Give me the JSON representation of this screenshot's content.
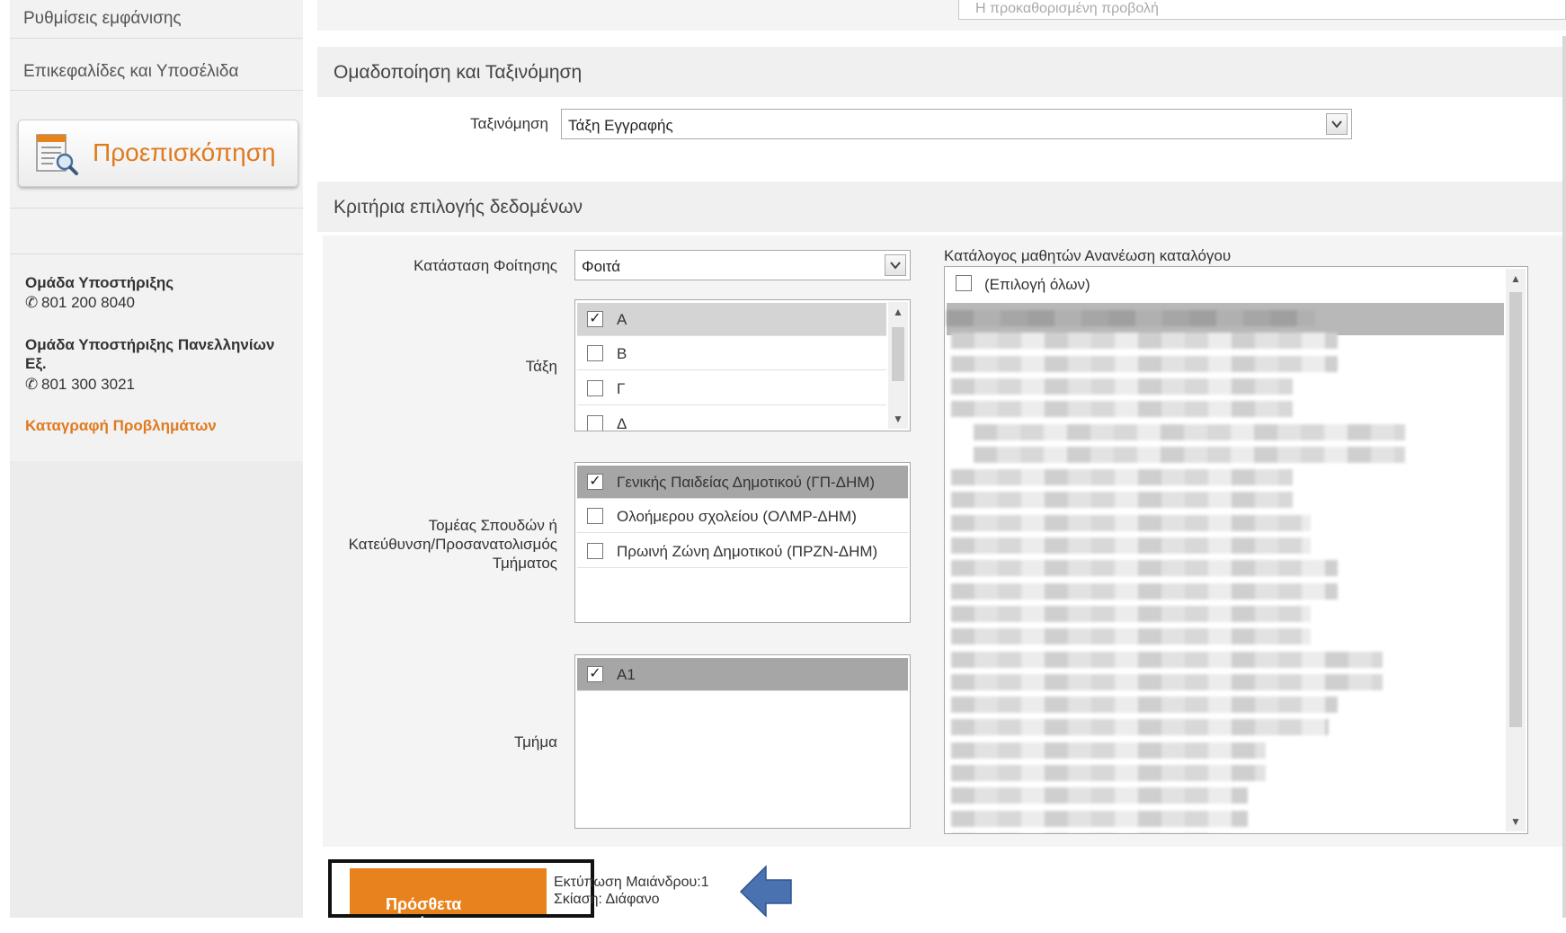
{
  "sidebar": {
    "links": [
      "Ρυθμίσεις εμφάνισης",
      "Επικεφαλίδες και Υποσέλιδα"
    ],
    "preview_button": "Προεπισκόπηση",
    "support": [
      {
        "title": "Ομάδα Υποστήριξης",
        "phone": "801 200 8040"
      },
      {
        "title": "Ομάδα Υποστήριξης Πανελληνίων Εξ.",
        "phone": "801 300 3021"
      }
    ],
    "report_link": "Καταγραφή Προβλημάτων"
  },
  "top": {
    "dropdown_placeholder": "Η προκαθορισμένη προβολή"
  },
  "grouping": {
    "header": "Ομαδοποίηση και Ταξινόμηση",
    "sort_label": "Ταξινόμηση",
    "sort_value": "Τάξη Εγγραφής"
  },
  "criteria": {
    "header": "Κριτήρια επιλογής δεδομένων",
    "status_label": "Κατάσταση Φοίτησης",
    "status_value": "Φοιτά",
    "class_label": "Τάξη",
    "class_items": [
      {
        "label": "Α",
        "checked": true
      },
      {
        "label": "Β",
        "checked": false
      },
      {
        "label": "Γ",
        "checked": false
      },
      {
        "label": "Δ",
        "checked": false
      }
    ],
    "sector_label_lines": [
      "Τομέας Σπουδών ή",
      "Κατεύθυνση/Προσανατολισμός",
      "Τμήματος"
    ],
    "sector_items": [
      {
        "label": "Γενικής Παιδείας Δημοτικού (ΓΠ-ΔΗΜ)",
        "checked": true
      },
      {
        "label": "Ολοήμερου σχολείου (ΟΛΜΡ-ΔΗΜ)",
        "checked": false
      },
      {
        "label": "Πρωινή Ζώνη Δημοτικού (ΠΡΖΝ-ΔΗΜ)",
        "checked": false
      }
    ],
    "section_label": "Τμήμα",
    "section_items": [
      {
        "label": "Α1",
        "checked": true
      }
    ],
    "catalog_title": "Κατάλογος μαθητών",
    "catalog_refresh": "Ανανέωση καταλόγου",
    "select_all": "(Επιλογή όλων)"
  },
  "footer": {
    "more_criteria": "Πρόσθετα κριτήρια",
    "print_line1": "Εκτύπωση Μαιάνδρου:1",
    "print_line2": "Σκίαση: Διάφανο"
  },
  "colors": {
    "accent_orange": "#e8821c",
    "link_orange": "#e07a1f",
    "arrow_blue": "#4a72b0"
  }
}
